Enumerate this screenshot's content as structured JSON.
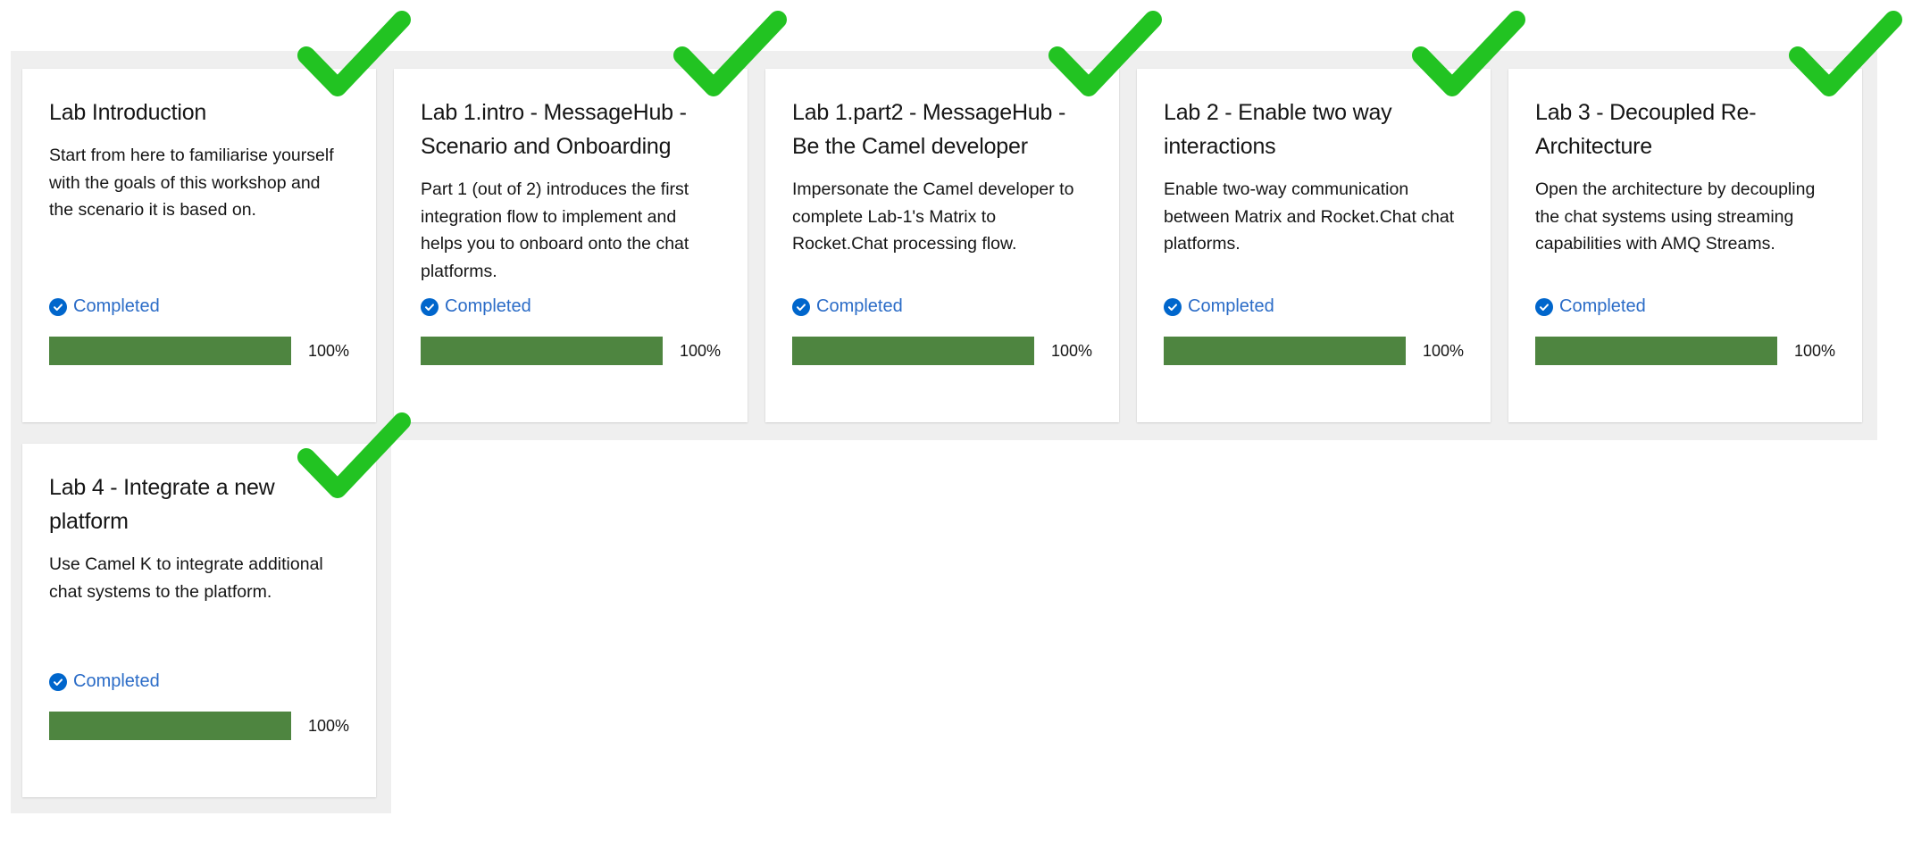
{
  "colors": {
    "status_blue": "#0066cc",
    "progress_green": "#4e8540",
    "checkmark_green": "#22c322",
    "panel_gray": "#efefef"
  },
  "cards": [
    {
      "title": "Lab Introduction",
      "description": "Start from here to familiarise yourself with the goals of this workshop and the scenario it is based on.",
      "status": "Completed",
      "progress": 1.0,
      "progress_label": "100%"
    },
    {
      "title": "Lab 1.intro - MessageHub - Scenario and Onboarding",
      "description": "Part 1 (out of 2) introduces the first integration flow to implement and helps you to onboard onto the chat platforms.",
      "status": "Completed",
      "progress": 1.0,
      "progress_label": "100%"
    },
    {
      "title": "Lab 1.part2 - MessageHub - Be the Camel developer",
      "description": "Impersonate the Camel developer to complete Lab-1's Matrix to Rocket.Chat processing flow.",
      "status": "Completed",
      "progress": 1.0,
      "progress_label": "100%"
    },
    {
      "title": "Lab 2 - Enable two way interactions",
      "description": "Enable two-way communication between Matrix and Rocket.Chat chat platforms.",
      "status": "Completed",
      "progress": 1.0,
      "progress_label": "100%"
    },
    {
      "title": "Lab 3 - Decoupled Re-Architecture",
      "description": "Open the architecture by decoupling the chat systems using streaming capabilities with AMQ Streams.",
      "status": "Completed",
      "progress": 1.0,
      "progress_label": "100%"
    },
    {
      "title": "Lab 4 - Integrate a new platform",
      "description": "Use Camel K to integrate additional chat systems to the platform.",
      "status": "Completed",
      "progress": 1.0,
      "progress_label": "100%"
    }
  ]
}
